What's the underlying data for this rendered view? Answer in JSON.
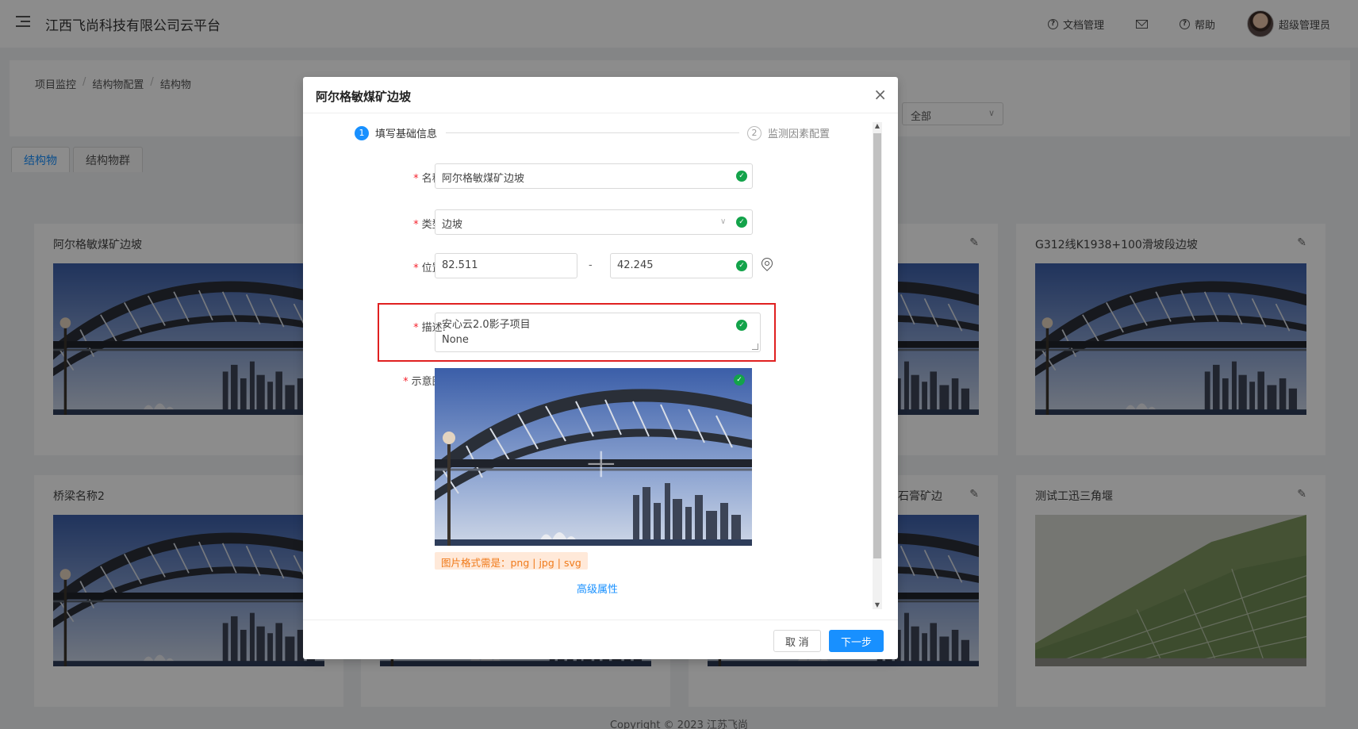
{
  "header": {
    "app_title": "江西飞尚科技有限公司云平台",
    "docs_label": "文档管理",
    "help_label": "帮助",
    "user_name": "超级管理员"
  },
  "breadcrumb": [
    "项目监控",
    "结构物配置",
    "结构物"
  ],
  "filter": {
    "selected": "全部"
  },
  "tabs": [
    "结构物",
    "结构物群"
  ],
  "cards": [
    {
      "title": "阿尔格敏煤矿边坡"
    },
    {
      "title": "G312线K1938+100滑坡段边坡"
    },
    {
      "title": "桥梁名称2"
    },
    {
      "title": "石膏矿边"
    },
    {
      "title": "测试工迅三角堰"
    }
  ],
  "footer": {
    "copyright": "Copyright © 2023 江苏飞尚"
  },
  "modal": {
    "title": "阿尔格敏煤矿边坡",
    "steps": [
      {
        "num": "1",
        "label": "填写基础信息"
      },
      {
        "num": "2",
        "label": "监测因素配置"
      }
    ],
    "fields": {
      "name": {
        "label": "名称:",
        "value": "阿尔格敏煤矿边坡"
      },
      "type": {
        "label": "类型:",
        "value": "边坡"
      },
      "location": {
        "label": "位置:",
        "lng": "82.511",
        "lat": "42.245",
        "separator": "-"
      },
      "description": {
        "label": "描述:",
        "line1": "安心云2.0影子项目",
        "line2": "None"
      },
      "image": {
        "label": "示意图:",
        "format_tip": "图片格式需是：png | jpg | svg"
      }
    },
    "advanced_label": "高级属性",
    "cancel_label": "取 消",
    "next_label": "下一步"
  }
}
